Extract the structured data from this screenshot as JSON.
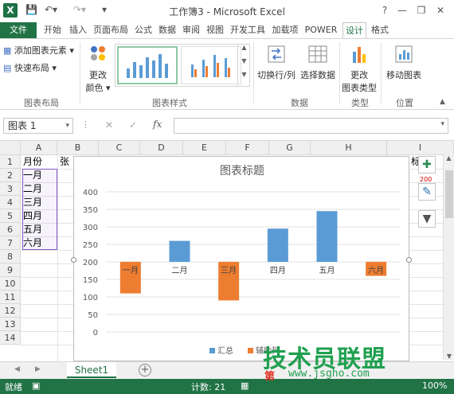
{
  "window": {
    "title": "工作簿3 - Microsoft Excel",
    "app_icon": "X",
    "help": "?",
    "minimize": "—",
    "restore": "❐",
    "close": "✕"
  },
  "tabs": [
    "文件",
    "开始",
    "插入",
    "页面布局",
    "公式",
    "数据",
    "审阅",
    "视图",
    "开发工具",
    "加载项",
    "POWER",
    "设计",
    "格式"
  ],
  "ribbon": {
    "add_element": "添加图表元素",
    "quick_layout": "快速布局",
    "change_colors_1": "更改",
    "change_colors_2": "颜色",
    "switch_row_col": "切换行/列",
    "select_data": "选择数据",
    "change_type_1": "更改",
    "change_type_2": "图表类型",
    "move_chart": "移动图表",
    "group_layout": "图表布局",
    "group_styles": "图表样式",
    "group_data": "数据",
    "group_type": "类型",
    "group_location": "位置"
  },
  "formula_bar": {
    "name_box": "图表 1",
    "cancel": "✕",
    "enter": "✓",
    "fx": "fx",
    "value": ""
  },
  "grid": {
    "columns": [
      "A",
      "B",
      "C",
      "D",
      "E",
      "F",
      "G",
      "H",
      "I"
    ],
    "rows": [
      "1",
      "2",
      "3",
      "4",
      "5",
      "6",
      "7",
      "8",
      "9",
      "10",
      "11",
      "12",
      "13",
      "14"
    ],
    "a_values": [
      "月份",
      "一月",
      "二月",
      "三月",
      "四月",
      "五月",
      "六月"
    ],
    "b1": "张",
    "i1": "标",
    "i2": "200"
  },
  "chart_data": {
    "type": "bar",
    "title": "图表标题",
    "categories": [
      "一月",
      "二月",
      "三月",
      "四月",
      "五月",
      "六月"
    ],
    "series": [
      {
        "name": "汇总",
        "color": "#5b9bd5",
        "values": [
          null,
          60,
          null,
          95,
          145,
          null
        ]
      },
      {
        "name": "辅助列",
        "color": "#ed7d31",
        "values": [
          -90,
          null,
          -110,
          null,
          null,
          -40
        ]
      }
    ],
    "ylim": [
      0,
      400
    ],
    "yticks": [
      "400",
      "350",
      "300",
      "250",
      "200",
      "150",
      "100",
      "50",
      "0"
    ],
    "baseline": 200,
    "legend": "bottom"
  },
  "sheet": {
    "name": "Sheet1",
    "add": "+"
  },
  "status": {
    "mode": "就绪",
    "count": "计数: 21",
    "zoom": "100%"
  },
  "watermark": {
    "main": "技术员联盟",
    "sub": "第",
    "url": "www.jsgho.com"
  }
}
